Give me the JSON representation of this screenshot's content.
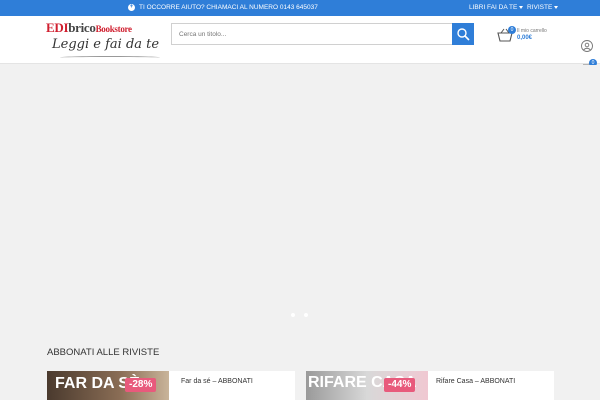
{
  "topbar": {
    "help_text": "TI OCCORRE AIUTO? CHIAMACI AL NUMERO 0143 645037",
    "menu_1": "LIBRI FAI DA TE",
    "menu_2": "RIVISTE"
  },
  "logo": {
    "line1_part1": "EDI",
    "line1_part2": "brico",
    "line1_part3": "Bookstore",
    "line2": "Leggi e fai da te"
  },
  "search": {
    "placeholder": "Cerca un titolo..."
  },
  "cart": {
    "count": "0",
    "label": "Il mio carrello",
    "total": "0,00€"
  },
  "sidebar": {
    "wishlist_count": "0",
    "cart_count": "0"
  },
  "main": {
    "section_title": "ABBONATI ALLE RIVISTE",
    "products": [
      {
        "name": "Far da sé – ABBONATI",
        "discount": "-28%",
        "cover_text": "FAR DA SÈ"
      },
      {
        "name": "Rifare Casa – ABBONATI",
        "discount": "-44%",
        "cover_text": "RIFARE CASA"
      }
    ]
  },
  "colors": {
    "accent": "#2f7ed8",
    "brand_red": "#d01f2f",
    "discount": "#e85a7c"
  }
}
